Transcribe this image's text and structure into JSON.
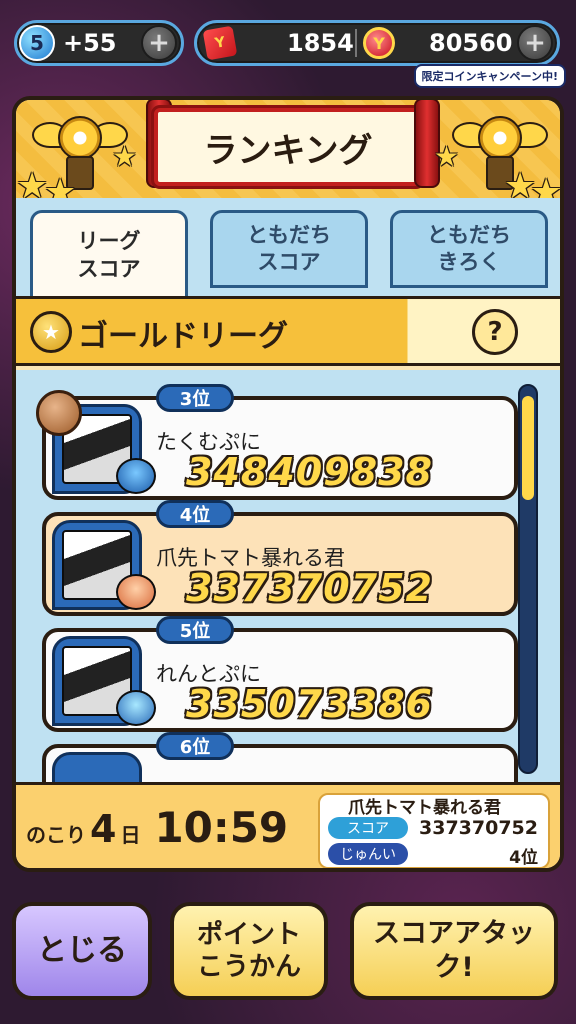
{
  "topbar": {
    "stamina_level": "5",
    "stamina_value": "+55",
    "tickets": "1854",
    "coins": "80560",
    "campaign_label": "限定コインキャンペーン中!"
  },
  "panel": {
    "title": "ランキング",
    "tabs": [
      {
        "label_line1": "リーグ",
        "label_line2": "スコア",
        "active": true
      },
      {
        "label_line1": "ともだち",
        "label_line2": "スコア",
        "active": false
      },
      {
        "label_line1": "ともだち",
        "label_line2": "きろく",
        "active": false
      }
    ],
    "league_title": "ゴールドリーグ",
    "help_label": "?"
  },
  "ranking": [
    {
      "rank": "3位",
      "name": "たくむぷに",
      "score": "348409838",
      "mine": false
    },
    {
      "rank": "4位",
      "name": "爪先トマト暴れる君",
      "score": "337370752",
      "mine": true
    },
    {
      "rank": "5位",
      "name": "れんとぷに",
      "score": "335073386",
      "mine": false
    },
    {
      "rank": "6位",
      "name": "",
      "score": "",
      "mine": false
    }
  ],
  "footer": {
    "remaining_label": "のこり",
    "days": "4",
    "days_unit": "日",
    "time": "10:59",
    "my_name": "爪先トマト暴れる君",
    "score_chip": "スコア",
    "score_value": "337370752",
    "rank_chip": "じゅんい",
    "rank_value": "4位"
  },
  "buttons": {
    "close": "とじる",
    "points_line1": "ポイント",
    "points_line2": "こうかん",
    "attack": "スコアアタック!"
  },
  "colors": {
    "accent_gold": "#ffd84a",
    "rank_blue": "#2b6ab8",
    "tab_blue": "#bfe1f2"
  }
}
